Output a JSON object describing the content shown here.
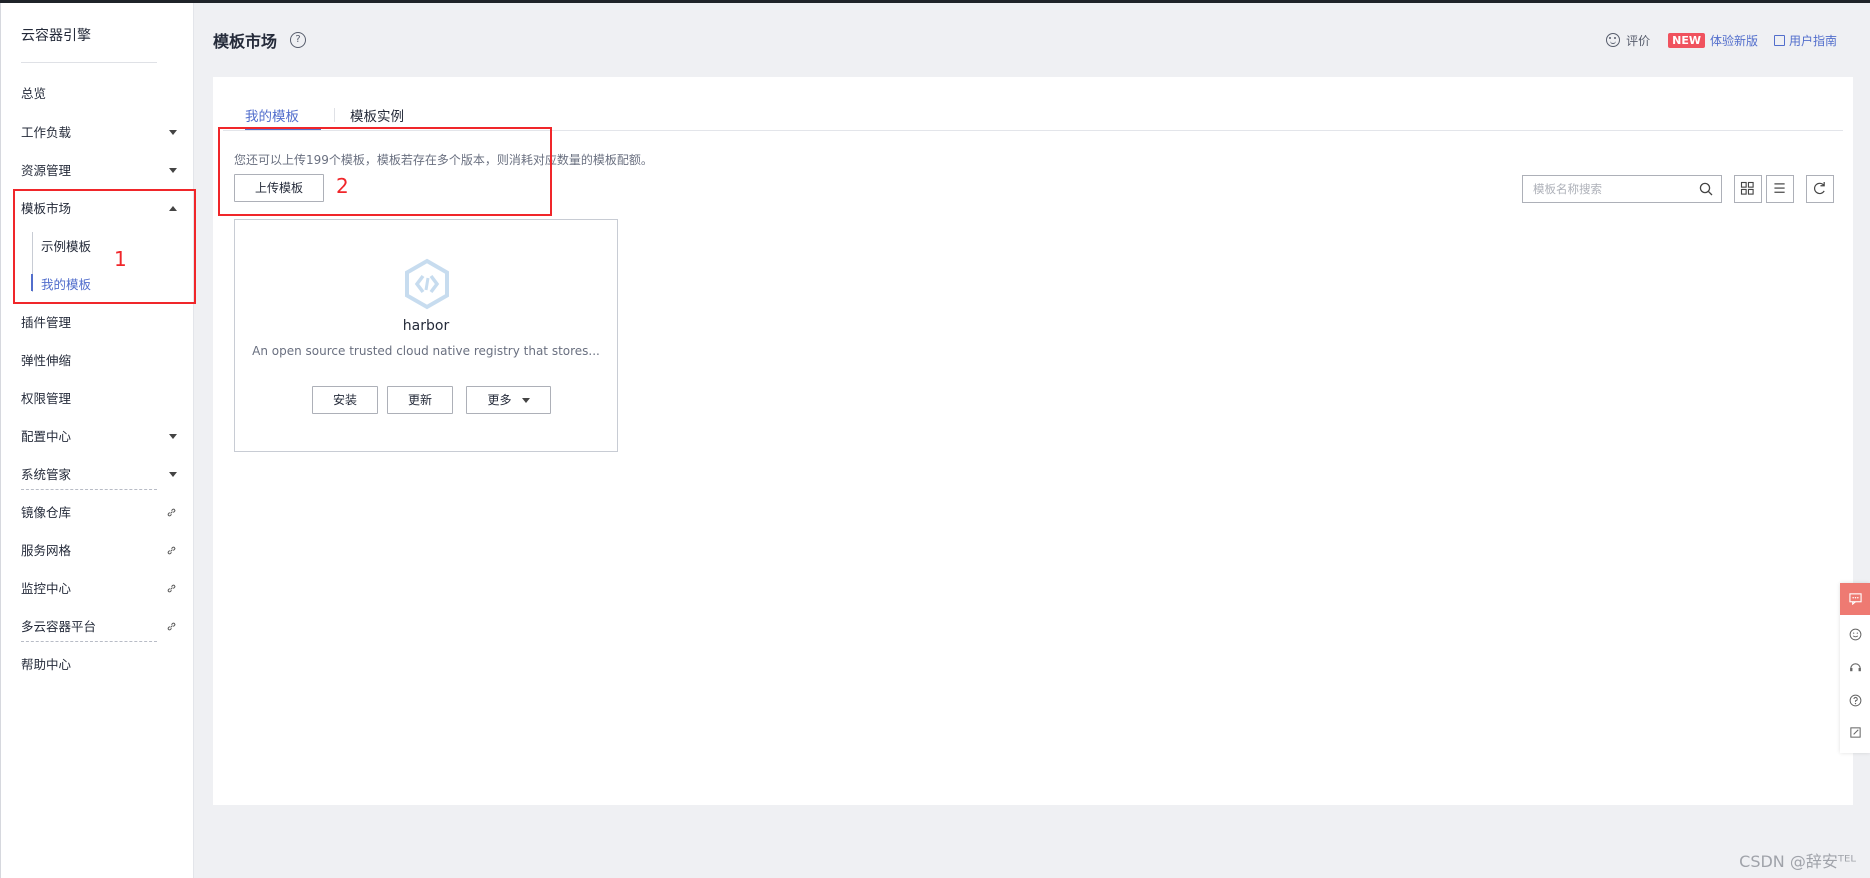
{
  "sidebar": {
    "title": "云容器引擎",
    "items": [
      {
        "label": "总览"
      },
      {
        "label": "工作负载"
      },
      {
        "label": "资源管理"
      },
      {
        "label": "模板市场"
      },
      {
        "label": "插件管理"
      },
      {
        "label": "弹性伸缩"
      },
      {
        "label": "权限管理"
      },
      {
        "label": "配置中心"
      },
      {
        "label": "系统管家"
      },
      {
        "label": "镜像仓库"
      },
      {
        "label": "服务网格"
      },
      {
        "label": "监控中心"
      },
      {
        "label": "多云容器平台"
      },
      {
        "label": "帮助中心"
      }
    ],
    "sub_items": [
      {
        "label": "示例模板"
      },
      {
        "label": "我的模板"
      }
    ]
  },
  "annotations": {
    "box1": "1",
    "box2": "2"
  },
  "header": {
    "title": "模板市场",
    "help": "?",
    "rate": "评价",
    "new_badge": "NEW",
    "new_version": "体验新版",
    "user_guide": "用户指南"
  },
  "tabs": [
    {
      "label": "我的模板"
    },
    {
      "label": "模板实例"
    }
  ],
  "main": {
    "tip": "您还可以上传199个模板，模板若存在多个版本，则消耗对应数量的模板配额。",
    "upload_label": "上传模板",
    "search_placeholder": "模板名称搜索"
  },
  "card": {
    "name": "harbor",
    "description": "An open source trusted cloud native registry that stores...",
    "install_label": "安装",
    "update_label": "更新",
    "more_label": "更多"
  },
  "watermark": "CSDN @辞安ᵀᴱᴸ",
  "colors": {
    "accent": "#526ecc",
    "annotation": "#f0262a",
    "new_badge": "#f0525e"
  }
}
